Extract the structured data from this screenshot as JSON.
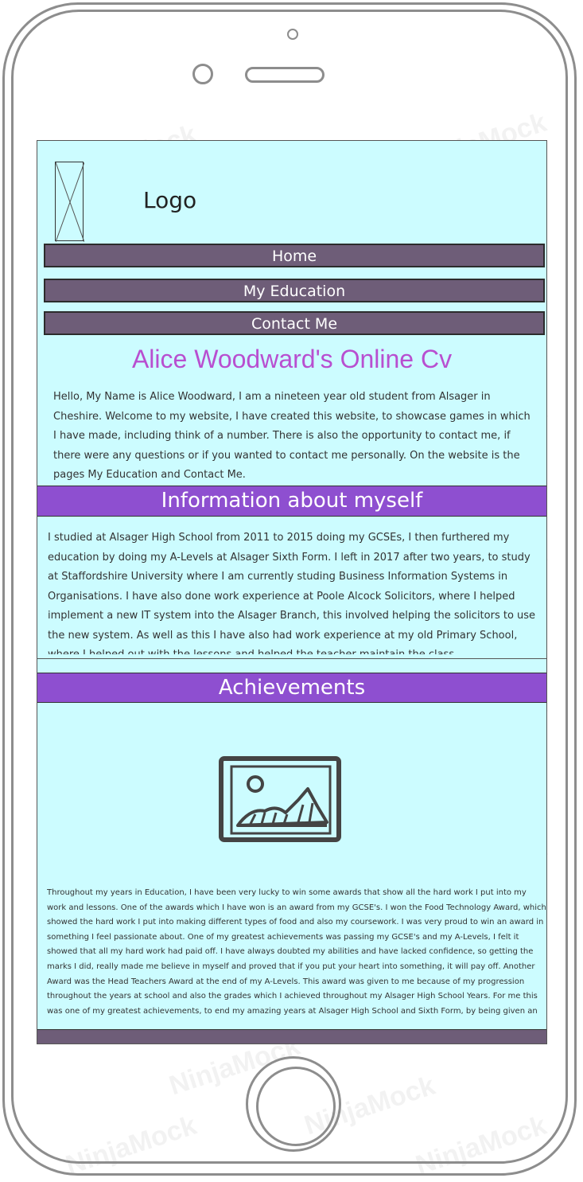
{
  "header": {
    "logo_text": "Logo"
  },
  "nav": {
    "items": [
      "Home",
      "My Education",
      "Contact Me"
    ]
  },
  "main": {
    "title": "Alice Woodward's Online Cv",
    "intro": "Hello, My Name is Alice Woodward, I am a nineteen year old student from Alsager in Cheshire. Welcome to my website, I have created this website, to showcase games in which I have made, including think of a number. There is also the opportunity to contact me, if there were any questions or if you wanted to contact me personally. On the website is the pages My Education and Contact Me."
  },
  "info_section": {
    "heading": "Information about myself",
    "text": "I studied at Alsager High School from 2011 to 2015 doing my GCSEs, I then furthered my education by doing my A-Levels at Alsager Sixth Form. I left in 2017 after two years, to study at Staffordshire University where I am currently studing Business Information Systems in Organisations. I have also done work experience at Poole Alcock Solicitors, where I helped implement a new IT system into the Alsager Branch, this involved helping the solicitors to use the new system. As well as this I have also had work experience at my old Primary School, where I helped out with the lessons and helped the teacher maintain the class."
  },
  "achievements_section": {
    "heading": "Achievements",
    "image_icon": "image-placeholder-icon",
    "text": "Throughout my years in Education, I have been very lucky to win some awards that show all the hard work I put into my work and lessons.  One of the awards which I have won is an award from my GCSE's. I won the Food Technology Award, which showed the hard work I put into making different types of food and also my coursework. I was very proud to win an award in something I feel passionate about.  One of my greatest achievements was passing my GCSE's and my A-Levels, I felt it showed that all my hard work had paid off. I have always doubted my abilities and have lacked confidence, so getting the marks I did, really made me believe in myself and proved that if you put your heart into something, it will pay off.  Another Award was the Head Teachers Award at the end of my A-Levels. This award was given to me because of my progression throughout the years at school and also the grades which I achieved throughout my Alsager High School Years. For me this was one of my greatest achievements, to end my amazing years at Alsager High School and Sixth Form, by being given an award for all my hard work. The image to the left is of myself getting the award which"
  },
  "watermark": "NinjaMock",
  "colors": {
    "screen_bg": "#ccfcff",
    "nav_bg": "#6e5d78",
    "section_bg": "#8e4fd0",
    "title_color": "#b84fd0"
  }
}
